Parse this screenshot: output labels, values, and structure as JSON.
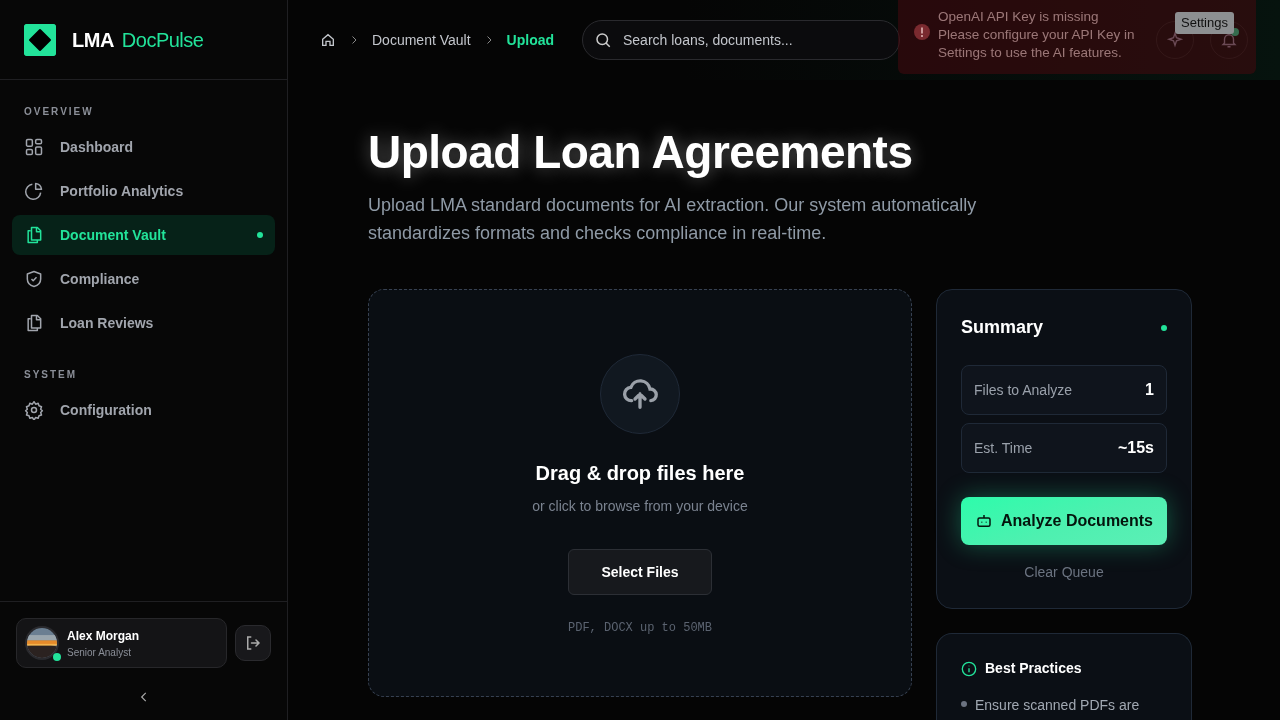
{
  "brand": {
    "name": "LMA",
    "suffix": "DocPulse"
  },
  "sidebar": {
    "sections": [
      {
        "title": "OVERVIEW",
        "items": [
          {
            "label": "Dashboard",
            "kind": "grid",
            "selected": false
          },
          {
            "label": "Portfolio Analytics",
            "kind": "pie",
            "selected": false
          },
          {
            "label": "Document Vault",
            "kind": "files",
            "selected": true
          },
          {
            "label": "Compliance",
            "kind": "shield",
            "selected": false
          },
          {
            "label": "Loan Reviews",
            "kind": "files",
            "selected": false
          }
        ]
      },
      {
        "title": "SYSTEM",
        "items": [
          {
            "label": "Configuration",
            "kind": "gear",
            "selected": false
          }
        ]
      }
    ]
  },
  "user": {
    "name": "Alex Morgan",
    "role": "Senior Analyst",
    "online": true
  },
  "breadcrumb": [
    {
      "label": "Document Vault",
      "current": false
    },
    {
      "label": "Upload",
      "current": true
    }
  ],
  "search": {
    "placeholder": "Search loans, documents..."
  },
  "notifications": {
    "unread": true
  },
  "toast": {
    "title": "OpenAI API Key is missing",
    "message": "Please configure your API Key in Settings to use the AI features.",
    "action": "Settings"
  },
  "page": {
    "title": "Upload Loan Agreements",
    "subtitle": "Upload LMA standard documents for AI extraction. Our system automatically standardizes formats and checks compliance in real-time."
  },
  "dropzone": {
    "title": "Drag & drop files here",
    "hint": "or click to browse from your device",
    "button": "Select Files",
    "formats": "PDF, DOCX up to 50MB"
  },
  "summary": {
    "title": "Summary",
    "live": true,
    "stats": [
      {
        "label": "Files to Analyze",
        "value": "1"
      },
      {
        "label": "Est. Time",
        "value": "~15s"
      }
    ],
    "primary": "Analyze Documents",
    "secondary": "Clear Queue"
  },
  "tips": {
    "title": "Best Practices",
    "items": [
      "Ensure scanned PDFs are"
    ]
  }
}
